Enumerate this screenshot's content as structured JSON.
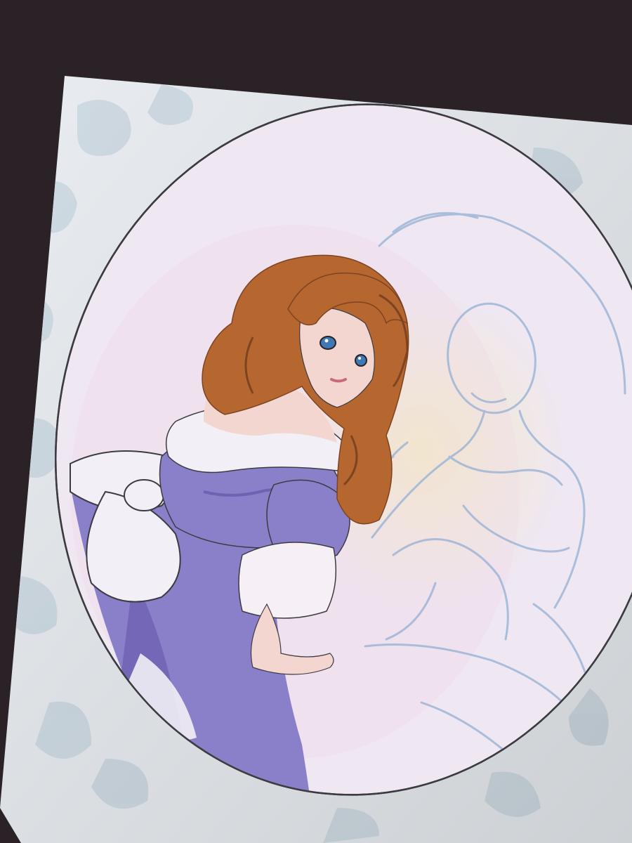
{
  "photo": {
    "subject": "",
    "colors": {
      "surround": "#2a2226",
      "canvas": "#e9edf1",
      "pattern": "#cdd9e2",
      "oval_fill": "#efe7f1",
      "oval_edge": "#3d3b42",
      "hair": "#b5672f",
      "hair_shadow": "#7e4320",
      "skin": "#f3d6cf",
      "eyes": "#3f78b4",
      "dress": "#8a7fc9",
      "dress_shadow": "#6f62b3",
      "white_trim": "#f2eff6",
      "sketch_line": "#9fb6d6",
      "glow": "#f4ecb8"
    }
  }
}
